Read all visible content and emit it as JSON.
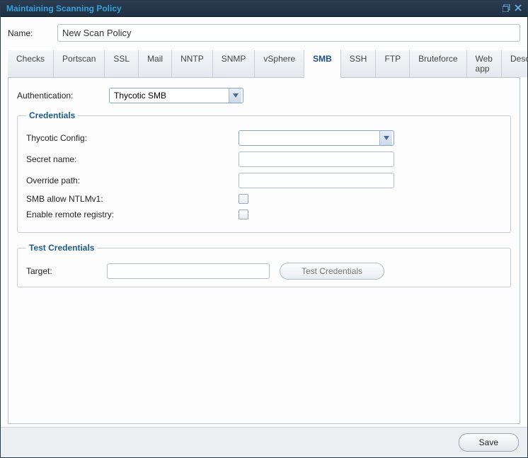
{
  "window": {
    "title": "Maintaining Scanning Policy"
  },
  "form": {
    "name_label": "Name:",
    "name_value": "New Scan Policy"
  },
  "tabs": [
    {
      "label": "Checks"
    },
    {
      "label": "Portscan"
    },
    {
      "label": "SSL"
    },
    {
      "label": "Mail"
    },
    {
      "label": "NNTP"
    },
    {
      "label": "SNMP"
    },
    {
      "label": "vSphere"
    },
    {
      "label": "SMB"
    },
    {
      "label": "SSH"
    },
    {
      "label": "FTP"
    },
    {
      "label": "Bruteforce"
    },
    {
      "label": "Web app"
    },
    {
      "label": "Description"
    }
  ],
  "active_tab_index": 7,
  "auth": {
    "label": "Authentication:",
    "value": "Thycotic SMB"
  },
  "credentials": {
    "legend": "Credentials",
    "thycotic_config_label": "Thycotic Config:",
    "thycotic_config_value": "",
    "secret_name_label": "Secret name:",
    "secret_name_value": "",
    "override_path_label": "Override path:",
    "override_path_value": "",
    "smb_ntlmv1_label": "SMB allow NTLMv1:",
    "smb_ntlmv1_checked": false,
    "enable_remote_registry_label": "Enable remote registry:",
    "enable_remote_registry_checked": false
  },
  "test": {
    "legend": "Test Credentials",
    "target_label": "Target:",
    "target_value": "",
    "button_label": "Test Credentials"
  },
  "footer": {
    "save_label": "Save"
  }
}
